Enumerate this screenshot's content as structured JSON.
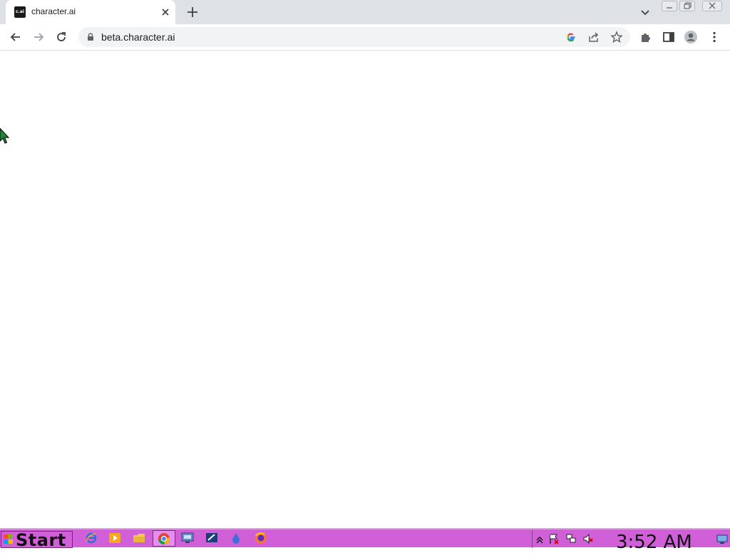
{
  "browser": {
    "tab": {
      "favicon_text": "c.ai",
      "title": "character.ai"
    },
    "address_bar": {
      "url": "beta.character.ai"
    }
  },
  "taskbar": {
    "start_label": "Start",
    "clock": "3:52 AM",
    "color": "#d15fd8"
  },
  "icons": {
    "tab": [
      "character-ai-favicon",
      "close-icon",
      "plus-icon",
      "chevron-down-icon"
    ],
    "window": [
      "minimize-icon",
      "restore-icon",
      "close-icon"
    ],
    "toolbar": [
      "back-arrow-icon",
      "forward-arrow-icon",
      "reload-icon",
      "lock-icon",
      "google-g-icon",
      "share-icon",
      "star-icon",
      "puzzle-extension-icon",
      "side-panel-icon",
      "profile-icon",
      "kebab-menu-icon"
    ],
    "taskbar_quicklaunch": [
      "internet-explorer-icon",
      "media-player-icon",
      "file-explorer-icon",
      "chrome-icon",
      "monitor-icon",
      "paint-icon",
      "water-drop-icon",
      "firefox-icon"
    ],
    "tray": [
      "chevron-up-icon",
      "flag-icon",
      "network-icon",
      "speaker-muted-icon",
      "show-desktop-icon"
    ]
  }
}
